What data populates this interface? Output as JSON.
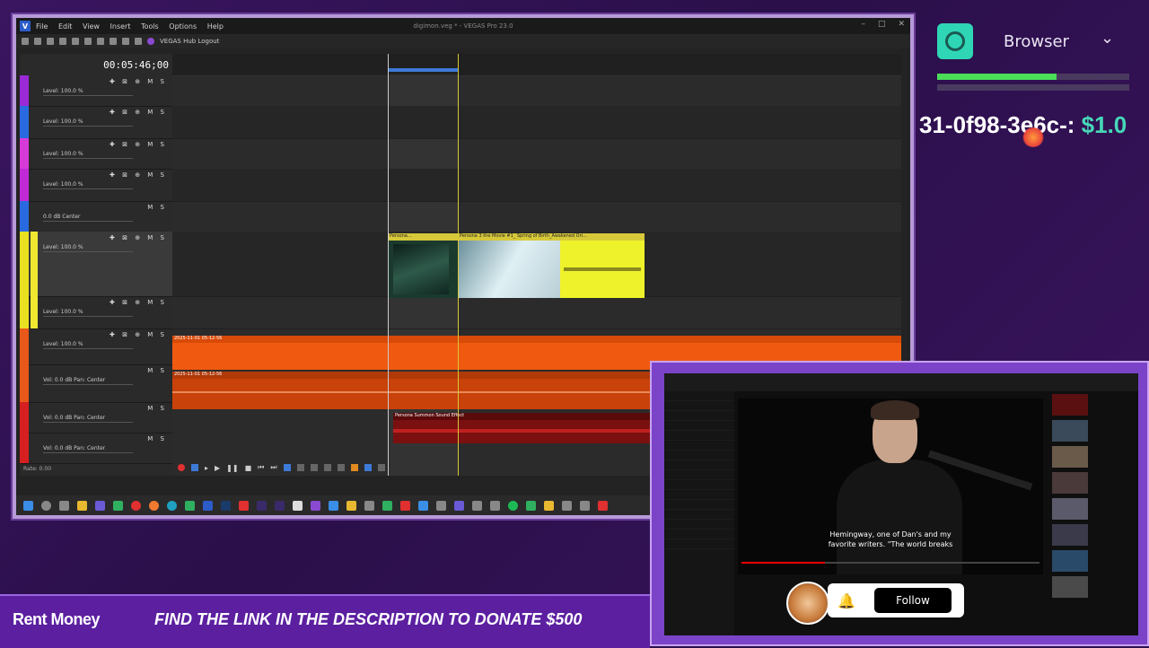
{
  "vegas": {
    "menu": [
      "File",
      "Edit",
      "View",
      "Insert",
      "Tools",
      "Options",
      "Help"
    ],
    "window_title": "digimon.veg * - VEGAS Pro 23.0",
    "hub_label": "VEGAS Hub Logout",
    "timecode": "00:05:46;00",
    "tracks": [
      {
        "level": "Level: 100.0 %"
      },
      {
        "level": "Level: 100.0 %"
      },
      {
        "level": "Level: 100.0 %"
      },
      {
        "level": "Level: 100.0 %"
      },
      {
        "vol": "0.0 dB",
        "pan": "Center"
      },
      {
        "level": "Level: 100.0 %"
      },
      {
        "level": "Level: 100.0 %"
      },
      {
        "level": "Level: 100.0 %"
      },
      {
        "vol": "0.0 dB",
        "pan": "Center",
        "vol_lbl": "Vol:",
        "pan_lbl": "Pan:"
      },
      {
        "vol": "0.0 dB",
        "pan": "Center",
        "vol_lbl": "Vol:",
        "pan_lbl": "Pan:"
      },
      {
        "vol": "0.0 dB",
        "pan": "Center",
        "vol_lbl": "Vol:",
        "pan_lbl": "Pan:"
      }
    ],
    "rate": "Rate: 0.00",
    "clips": {
      "video1": "Persona…",
      "video2": "Persona 3 the Movie #1_ Spring of Birth_Awakened Ori…",
      "orange1": "2025-11-01 05-12-56",
      "orange2": "2025-11-01 05-12-56",
      "sfx": "Persona Summon Sound Effect"
    }
  },
  "browser_panel": {
    "title": "Browser",
    "meter1": 0.62,
    "meter2": 0.0
  },
  "ticker": {
    "id": "31-0f98-3e6c-: ",
    "amount": "$1.0"
  },
  "youtube": {
    "caption_line1": "Hemingway, one of Dan's and my",
    "caption_line2": "favorite writers. \"The world breaks",
    "progress": 0.28
  },
  "follow": {
    "label": "Follow"
  },
  "banner": {
    "left": "Rent Money",
    "marquee": "FIND THE LINK IN THE DESCRIPTION TO DONATE  $500"
  }
}
